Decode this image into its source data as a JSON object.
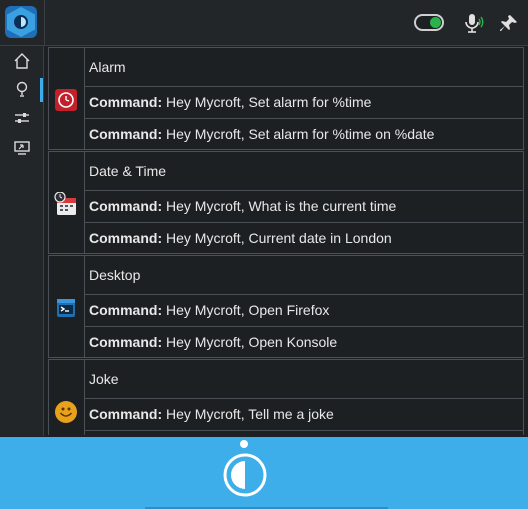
{
  "header": {
    "toggle_state": "on",
    "accent_color": "#3daee9",
    "toggle_color": "#29b34a"
  },
  "sidebar": {
    "items": [
      {
        "icon": "home-icon"
      },
      {
        "icon": "lightbulb-icon",
        "active": true
      },
      {
        "icon": "sliders-icon"
      },
      {
        "icon": "screen-share-icon"
      }
    ]
  },
  "skills": [
    {
      "title": "Alarm",
      "icon": "alarm-clock-icon",
      "commands": [
        {
          "label": "Command:",
          "text": " Hey Mycroft, Set alarm for %time"
        },
        {
          "label": "Command:",
          "text": " Hey Mycroft, Set alarm for %time on %date"
        }
      ]
    },
    {
      "title": "Date & Time",
      "icon": "calendar-clock-icon",
      "commands": [
        {
          "label": "Command:",
          "text": " Hey Mycroft, What is the current time"
        },
        {
          "label": "Command:",
          "text": " Hey Mycroft, Current date in London"
        }
      ]
    },
    {
      "title": "Desktop",
      "icon": "terminal-icon",
      "commands": [
        {
          "label": "Command:",
          "text": " Hey Mycroft, Open Firefox"
        },
        {
          "label": "Command:",
          "text": " Hey Mycroft, Open Konsole"
        }
      ]
    },
    {
      "title": "Joke",
      "icon": "smiley-face-icon",
      "commands": [
        {
          "label": "Command:",
          "text": " Hey Mycroft, Tell me a joke"
        }
      ]
    }
  ]
}
